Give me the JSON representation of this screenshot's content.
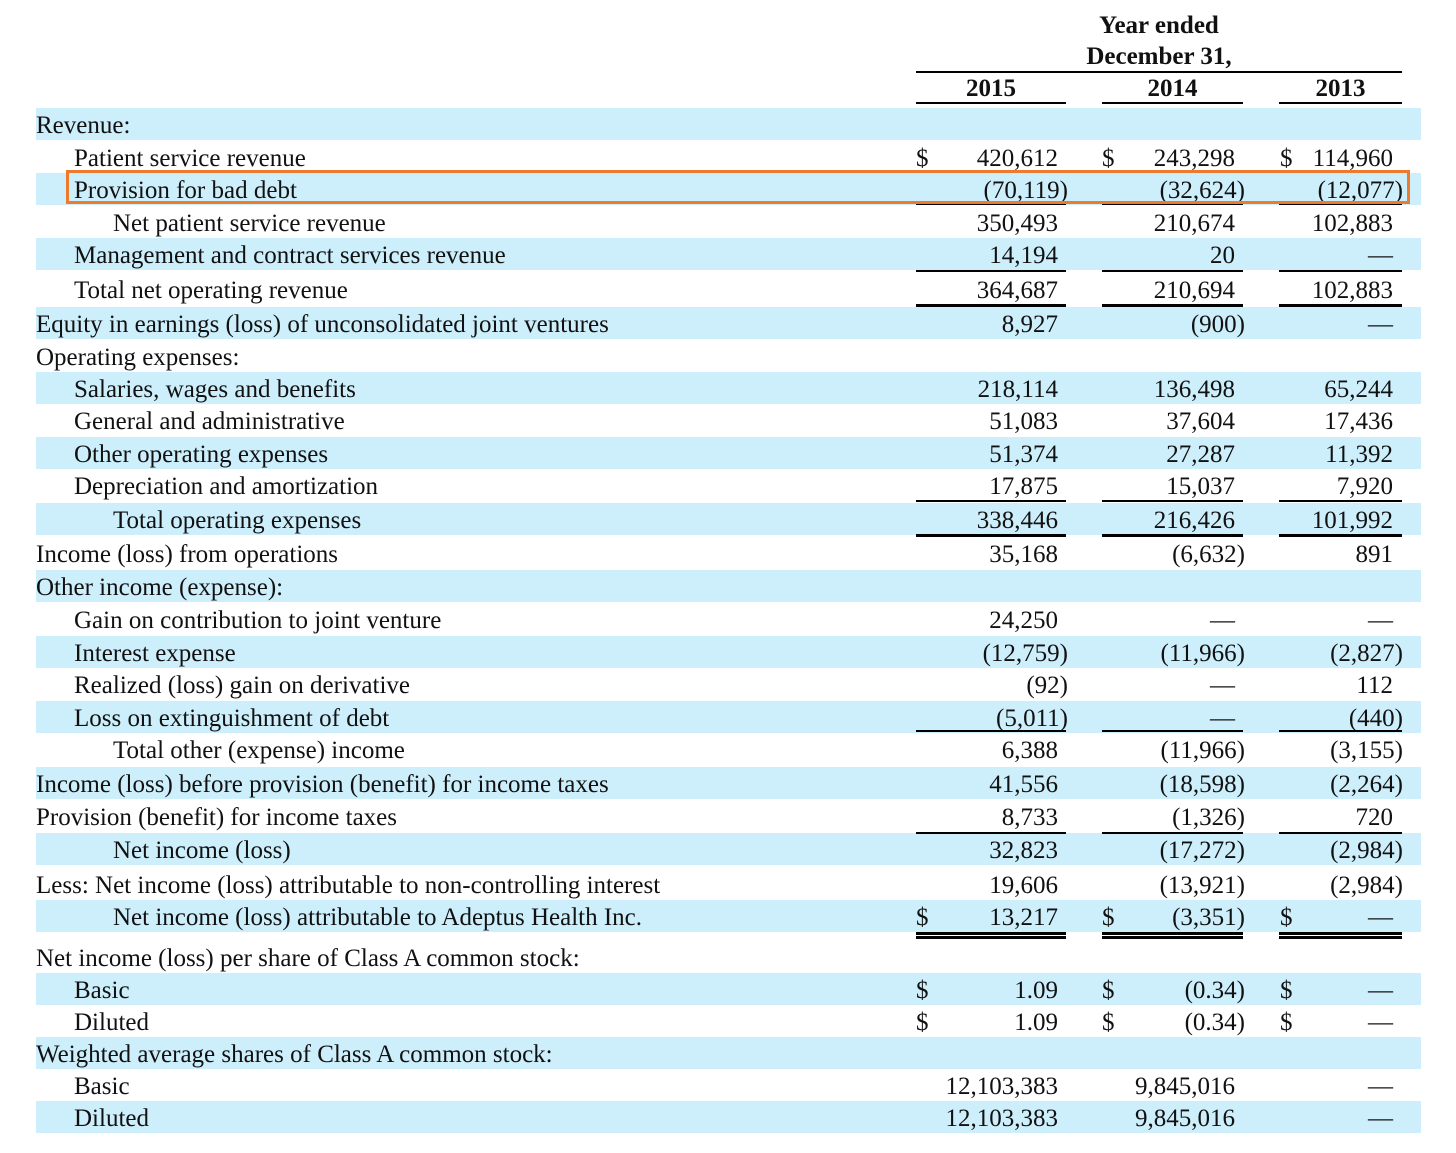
{
  "header": {
    "title_line1": "Year ended",
    "title_line2": "December 31,",
    "years": [
      "2015",
      "2014",
      "2013"
    ]
  },
  "currency_symbol": "$",
  "highlight_color": "#ee7a2d",
  "row_shade_color": "#cdeefb",
  "rows": [
    {
      "label": "Revenue:",
      "values": [
        "",
        "",
        ""
      ]
    },
    {
      "label": "Patient service revenue",
      "values": [
        "420,612",
        "243,298",
        "114,960"
      ]
    },
    {
      "label": "Provision for bad debt",
      "values": [
        "(70,119)",
        "(32,624)",
        "(12,077)"
      ]
    },
    {
      "label": "Net patient service revenue",
      "values": [
        "350,493",
        "210,674",
        "102,883"
      ]
    },
    {
      "label": "Management and contract services revenue",
      "values": [
        "14,194",
        "20",
        "—"
      ]
    },
    {
      "label": "Total net operating revenue",
      "values": [
        "364,687",
        "210,694",
        "102,883"
      ]
    },
    {
      "label": "Equity in earnings (loss) of unconsolidated joint ventures",
      "values": [
        "8,927",
        "(900)",
        "—"
      ]
    },
    {
      "label": "Operating expenses:",
      "values": [
        "",
        "",
        ""
      ]
    },
    {
      "label": "Salaries, wages and benefits",
      "values": [
        "218,114",
        "136,498",
        "65,244"
      ]
    },
    {
      "label": "General and administrative",
      "values": [
        "51,083",
        "37,604",
        "17,436"
      ]
    },
    {
      "label": "Other operating expenses",
      "values": [
        "51,374",
        "27,287",
        "11,392"
      ]
    },
    {
      "label": "Depreciation and amortization",
      "values": [
        "17,875",
        "15,037",
        "7,920"
      ]
    },
    {
      "label": "Total operating expenses",
      "values": [
        "338,446",
        "216,426",
        "101,992"
      ]
    },
    {
      "label": "Income (loss) from operations",
      "values": [
        "35,168",
        "(6,632)",
        "891"
      ]
    },
    {
      "label": "Other income (expense):",
      "values": [
        "",
        "",
        ""
      ]
    },
    {
      "label": "Gain on contribution to joint venture",
      "values": [
        "24,250",
        "—",
        "—"
      ]
    },
    {
      "label": "Interest expense",
      "values": [
        "(12,759)",
        "(11,966)",
        "(2,827)"
      ]
    },
    {
      "label": "Realized (loss) gain on derivative",
      "values": [
        "(92)",
        "—",
        "112"
      ]
    },
    {
      "label": "Loss on extinguishment of debt",
      "values": [
        "(5,011)",
        "—",
        "(440)"
      ]
    },
    {
      "label": "Total other (expense) income",
      "values": [
        "6,388",
        "(11,966)",
        "(3,155)"
      ]
    },
    {
      "label": "Income (loss) before provision (benefit) for income taxes",
      "values": [
        "41,556",
        "(18,598)",
        "(2,264)"
      ]
    },
    {
      "label": "Provision (benefit) for income taxes",
      "values": [
        "8,733",
        "(1,326)",
        "720"
      ]
    },
    {
      "label": "Net income (loss)",
      "values": [
        "32,823",
        "(17,272)",
        "(2,984)"
      ]
    },
    {
      "label": "Less: Net income (loss) attributable to non-controlling interest",
      "values": [
        "19,606",
        "(13,921)",
        "(2,984)"
      ]
    },
    {
      "label": "Net income (loss) attributable to Adeptus Health Inc.",
      "values": [
        "13,217",
        "(3,351)",
        "—"
      ]
    },
    {
      "label": "Net income (loss) per share of Class A common stock:",
      "values": [
        "",
        "",
        ""
      ]
    },
    {
      "label": "Basic",
      "values": [
        "1.09",
        "(0.34)",
        "—"
      ]
    },
    {
      "label": "Diluted",
      "values": [
        "1.09",
        "(0.34)",
        "—"
      ]
    },
    {
      "label": "Weighted average shares of Class A common stock:",
      "values": [
        "",
        "",
        ""
      ]
    },
    {
      "label": "Basic",
      "values": [
        "12,103,383",
        "9,845,016",
        "—"
      ]
    },
    {
      "label": "Diluted",
      "values": [
        "12,103,383",
        "9,845,016",
        "—"
      ]
    }
  ]
}
